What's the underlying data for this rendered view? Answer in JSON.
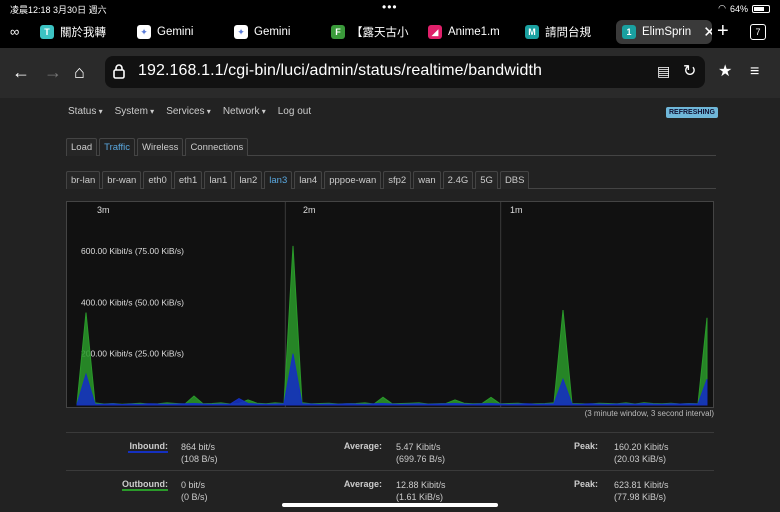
{
  "status_bar": {
    "time": "凌晨12:18",
    "date": "3月30日 週六",
    "battery": "64%"
  },
  "tabs": [
    {
      "title": "關於我轉",
      "icon_letter": "T",
      "icon_color": "#3cc3c3"
    },
    {
      "title": "Gemini",
      "icon_letter": "✦",
      "icon_color": "#ffffff"
    },
    {
      "title": "Gemini",
      "icon_letter": "✦",
      "icon_color": "#ffffff"
    },
    {
      "title": "【露天古小",
      "icon_letter": "F",
      "icon_color": "#3a9a3a"
    },
    {
      "title": "Anime1.m",
      "icon_letter": "◢",
      "icon_color": "#e0206a"
    },
    {
      "title": "請問台規",
      "icon_letter": "M",
      "icon_color": "#1aa0a0"
    },
    {
      "title": "ElimSprin",
      "icon_letter": "1",
      "icon_color": "#1aa0a0"
    }
  ],
  "tab_count": "7",
  "url": "192.168.1.1/cgi-bin/luci/admin/status/realtime/bandwidth",
  "menu": [
    "Status",
    "System",
    "Services",
    "Network",
    "Log out"
  ],
  "refresh_badge": "REFRESHING",
  "page_tabs": [
    "Load",
    "Traffic",
    "Wireless",
    "Connections"
  ],
  "page_tab_selected": "Traffic",
  "iface_tabs": [
    "br-lan",
    "br-wan",
    "eth0",
    "eth1",
    "lan1",
    "lan2",
    "lan3",
    "lan4",
    "pppoe-wan",
    "sfp2",
    "wan",
    "2.4G",
    "5G",
    "DBS"
  ],
  "iface_selected": "lan3",
  "graph": {
    "time_labels": [
      "3m",
      "2m",
      "1m"
    ],
    "y_labels": [
      "600.00 Kibit/s (75.00 KiB/s)",
      "400.00 Kibit/s (50.00 KiB/s)",
      "200.00 Kibit/s (25.00 KiB/s)"
    ],
    "caption": "(3 minute window, 3 second interval)",
    "inbound_color": "#1530c0",
    "outbound_color": "#2a9a2a"
  },
  "chart_data": {
    "type": "area",
    "x_window_seconds": 180,
    "x_interval_seconds": 3,
    "ylim_kibit": [
      0,
      760
    ],
    "series": [
      {
        "name": "Outbound",
        "values": [
          5,
          360,
          8,
          4,
          6,
          3,
          5,
          7,
          4,
          5,
          8,
          6,
          4,
          35,
          5,
          6,
          8,
          4,
          6,
          20,
          7,
          5,
          8,
          6,
          620,
          9,
          5,
          6,
          7,
          4,
          5,
          6,
          8,
          4,
          30,
          5,
          6,
          7,
          8,
          4,
          5,
          6,
          20,
          7,
          5,
          6,
          30,
          5,
          6,
          7,
          4,
          5,
          6,
          8,
          370,
          6,
          5,
          4,
          7,
          6,
          5,
          8,
          4,
          9,
          6,
          5,
          7,
          4,
          6,
          5,
          340
        ]
      },
      {
        "name": "Inbound",
        "values": [
          3,
          120,
          4,
          3,
          5,
          2,
          4,
          3,
          5,
          4,
          3,
          4,
          5,
          6,
          4,
          3,
          4,
          3,
          25,
          6,
          4,
          3,
          4,
          5,
          200,
          5,
          4,
          3,
          4,
          3,
          5,
          4,
          3,
          5,
          6,
          4,
          3,
          4,
          5,
          3,
          4,
          5,
          6,
          4,
          3,
          5,
          6,
          4,
          3,
          4,
          5,
          3,
          4,
          5,
          100,
          4,
          3,
          5,
          4,
          3,
          4,
          5,
          3,
          6,
          4,
          3,
          5,
          4,
          5,
          4,
          100
        ]
      }
    ]
  },
  "stats": {
    "inbound": {
      "label": "Inbound:",
      "cur": "864 bit/s",
      "cur_b": "(108 B/s)",
      "avg_label": "Average:",
      "avg": "5.47 Kibit/s",
      "avg_b": "(699.76 B/s)",
      "peak_label": "Peak:",
      "peak": "160.20 Kibit/s",
      "peak_b": "(20.03 KiB/s)"
    },
    "outbound": {
      "label": "Outbound:",
      "cur": "0 bit/s",
      "cur_b": "(0 B/s)",
      "avg_label": "Average:",
      "avg": "12.88 Kibit/s",
      "avg_b": "(1.61 KiB/s)",
      "peak_label": "Peak:",
      "peak": "623.81 Kibit/s",
      "peak_b": "(77.98 KiB/s)"
    }
  }
}
